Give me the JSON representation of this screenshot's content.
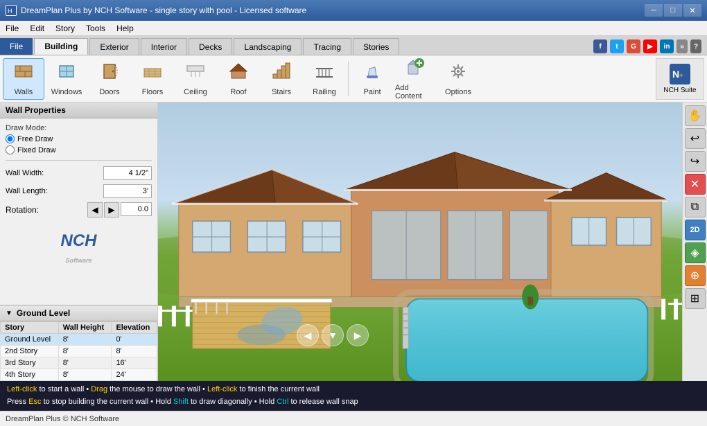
{
  "app": {
    "title": "DreamPlan Plus by NCH Software - single story with pool - Licensed software",
    "icon": "🏠"
  },
  "window_controls": {
    "minimize": "─",
    "maximize": "□",
    "close": "✕"
  },
  "menu": {
    "items": [
      "File",
      "Edit",
      "Story",
      "Tools",
      "Help"
    ]
  },
  "tabs": {
    "file": "File",
    "building": "Building",
    "exterior": "Exterior",
    "interior": "Interior",
    "decks": "Decks",
    "landscaping": "Landscaping",
    "tracing": "Tracing",
    "stories": "Stories"
  },
  "toolbar": {
    "tools": [
      {
        "id": "walls",
        "label": "Walls",
        "icon": "▦"
      },
      {
        "id": "windows",
        "label": "Windows",
        "icon": "⊞"
      },
      {
        "id": "doors",
        "label": "Doors",
        "icon": "🚪"
      },
      {
        "id": "floors",
        "label": "Floors",
        "icon": "▩"
      },
      {
        "id": "ceiling",
        "label": "Ceiling",
        "icon": "⬜"
      },
      {
        "id": "roof",
        "label": "Roof",
        "icon": "⌂"
      },
      {
        "id": "stairs",
        "label": "Stairs",
        "icon": "≡"
      },
      {
        "id": "railing",
        "label": "Railing",
        "icon": "⊟"
      },
      {
        "id": "paint",
        "label": "Paint",
        "icon": "🎨"
      },
      {
        "id": "add-content",
        "label": "Add Content",
        "icon": "📦"
      },
      {
        "id": "options",
        "label": "Options",
        "icon": "⚙"
      }
    ],
    "nch_suite": "NCH Suite"
  },
  "wall_properties": {
    "title": "Wall Properties",
    "draw_mode_label": "Draw Mode:",
    "free_draw": "Free Draw",
    "fixed_draw": "Fixed Draw",
    "wall_width_label": "Wall Width:",
    "wall_width_value": "4 1/2\"",
    "wall_length_label": "Wall Length:",
    "wall_length_value": "3'",
    "rotation_label": "Rotation:",
    "rotation_value": "0.0"
  },
  "nch_logo": "NCH",
  "ground_level": {
    "title": "Ground Level",
    "table_headers": [
      "Story",
      "Wall Height",
      "Elevation"
    ],
    "rows": [
      {
        "story": "Ground Level",
        "wall_height": "8'",
        "elevation": "0'"
      },
      {
        "story": "2nd Story",
        "wall_height": "8'",
        "elevation": "8'"
      },
      {
        "story": "3rd Story",
        "wall_height": "8'",
        "elevation": "16'"
      },
      {
        "story": "4th Story",
        "wall_height": "8'",
        "elevation": "24'"
      }
    ]
  },
  "instructions": {
    "line1_parts": [
      {
        "text": "Left-click",
        "style": "yellow"
      },
      {
        "text": " to start a wall • ",
        "style": "normal"
      },
      {
        "text": "Drag",
        "style": "yellow"
      },
      {
        "text": " the mouse to draw the wall • ",
        "style": "normal"
      },
      {
        "text": "Left-click",
        "style": "yellow"
      },
      {
        "text": " to finish the current wall",
        "style": "normal"
      }
    ],
    "line2_parts": [
      {
        "text": "Press ",
        "style": "normal"
      },
      {
        "text": "Esc",
        "style": "yellow"
      },
      {
        "text": " to stop building the current wall • Hold ",
        "style": "normal"
      },
      {
        "text": "Shift",
        "style": "cyan"
      },
      {
        "text": " to draw diagonally • Hold ",
        "style": "normal"
      },
      {
        "text": "Ctrl",
        "style": "cyan"
      },
      {
        "text": " to release wall snap",
        "style": "normal"
      }
    ]
  },
  "status_bar": {
    "text": "DreamPlan Plus © NCH Software"
  },
  "social": {
    "icons": [
      {
        "name": "facebook",
        "color": "#3b5998",
        "letter": "f"
      },
      {
        "name": "twitter",
        "color": "#1da1f2",
        "letter": "t"
      },
      {
        "name": "google",
        "color": "#dd4b39",
        "letter": "G"
      },
      {
        "name": "youtube",
        "color": "#ff0000",
        "letter": "▶"
      },
      {
        "name": "linkedin",
        "color": "#0077b5",
        "letter": "in"
      }
    ]
  },
  "right_toolbar": {
    "tools": [
      {
        "id": "hand",
        "icon": "✋",
        "style": "normal"
      },
      {
        "id": "undo-curve",
        "icon": "↩",
        "style": "normal"
      },
      {
        "id": "redo-curve",
        "icon": "↪",
        "style": "normal"
      },
      {
        "id": "delete",
        "icon": "✕",
        "style": "red"
      },
      {
        "id": "copy",
        "icon": "⧉",
        "style": "normal"
      },
      {
        "id": "2d",
        "icon": "2D",
        "style": "blue"
      },
      {
        "id": "3d",
        "icon": "◈",
        "style": "green"
      },
      {
        "id": "compass",
        "icon": "⊕",
        "style": "orange"
      },
      {
        "id": "grid",
        "icon": "⊞",
        "style": "normal"
      }
    ]
  }
}
